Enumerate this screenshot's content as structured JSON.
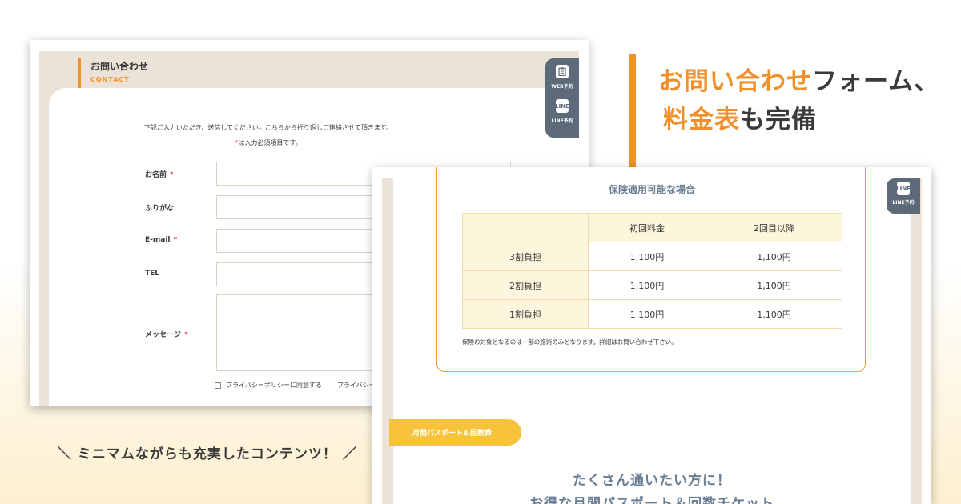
{
  "headline": {
    "line1_highlight": "お問い合わせ",
    "line1_rest": "フォーム、",
    "line2_highlight": "料金表",
    "line2_rest": "も完備"
  },
  "caption": "＼ ミニマムながらも充実したコンテンツ！ ／",
  "contact": {
    "title_jp": "お問い合わせ",
    "title_en": "CONTACT",
    "intro": "下記ご入力いただき、送信してください。こちらから折り返しご連絡させて頂きます。",
    "required_note": "は入力必須項目です。",
    "required_mark": "*",
    "fields": [
      {
        "label": "お名前",
        "required": "*"
      },
      {
        "label": "ふりがな",
        "required": ""
      },
      {
        "label": "E-mail",
        "required": "*"
      },
      {
        "label": "TEL",
        "required": ""
      },
      {
        "label": "メッセージ",
        "required": "*"
      }
    ],
    "privacy_label": "プライバシーポリシーに同意する",
    "privacy_link": "プライバシー"
  },
  "side_tabs": {
    "web_label": "WEB予約",
    "line_label": "LINE予約",
    "line_icon_text": "LINE"
  },
  "pricing": {
    "title": "保険適用可能な場合",
    "headers": [
      "",
      "初回料金",
      "2回目以降"
    ],
    "rows": [
      [
        "3割負担",
        "1,100円",
        "1,100円"
      ],
      [
        "2割負担",
        "1,100円",
        "1,100円"
      ],
      [
        "1割負担",
        "1,100円",
        "1,100円"
      ]
    ],
    "note": "保険の対象となるのは一部の施術のみとなります。詳細はお問い合わせ下さい。"
  },
  "pass": {
    "pill": "月間パスポート＆回数券",
    "heading1": "たくさん通いたい方に！",
    "heading2": "お得な月間パスポート＆回数チケット"
  },
  "colors": {
    "accent": "#f0902a",
    "yellow": "#f6c33a",
    "slate": "#5d6a7a",
    "beige": "#ece3d8"
  }
}
